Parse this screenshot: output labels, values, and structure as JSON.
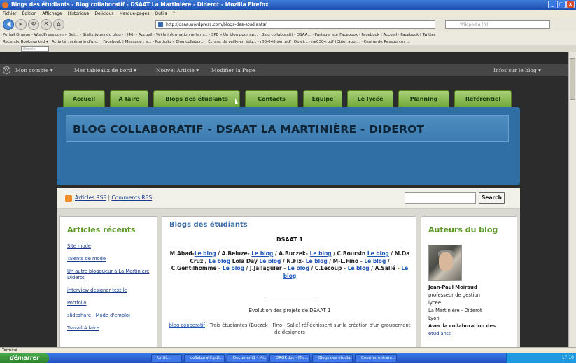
{
  "window": {
    "title": "Blogs des étudiants - Blog collaboratif - DSAAT La Martinière - Diderot - Mozilla Firefox",
    "min": "_",
    "max": "□",
    "close": "x"
  },
  "menu": [
    "Fichier",
    "Édition",
    "Affichage",
    "Historique",
    "Delicious",
    "Marque-pages",
    "Outils",
    "?"
  ],
  "nav": {
    "url": "http://dsaa.wordpress.com/blogs-des-etudiants/",
    "search_placeholder": "Wikipedia (fr)"
  },
  "bookmarks1": "Portail Orange  ·  WordPress.com » Get...  ·  Statistiques du blog  ·  I (46)  ·  Accueil  ·  Veille informationnelle m...  ·  SPE » Un blog pour ap...  ·  Blog collaboratif - DSAA...  ·  Partager sur Facebook  ·  Facebook | Accueil  ·  Facebook | Twitter",
  "bookmarks2": "Recently Bookmarked ▾  ·  Activité : scénario d'un...  ·  Facebook | Message : e...  ·  Portfolio » Blog collabor...  ·  Écrans de veille en édu...  ·  r08-046-syn.pdf (Objet...  ·  ne0304.pdf (Objet appl...  ·  Centre de Ressources ...",
  "google_toolbar": {
    "search": "Google"
  },
  "wp_adminbar": {
    "account": "Mon compte ▾",
    "dashboards": "Mes tableaux de bord ▾",
    "new_post": "Nouvel Article ▾",
    "edit_page": "Modifier la Page",
    "blog_info": "Infos sur le blog ▾"
  },
  "site": {
    "tabs": [
      "Accueil",
      "A faire",
      "Blogs des étudiants",
      "Contacts",
      "Equipe",
      "Le lycée",
      "Planning",
      "Référentiel"
    ],
    "title": "BLOG COLLABORATIF - DSAAT LA MARTINIÈRE - DIDEROT",
    "rss": {
      "articles": "Articles RSS",
      "sep": " | ",
      "comments": "Comments RSS"
    },
    "search_button": "Search"
  },
  "sidebar_left": {
    "heading": "Articles récents",
    "items": [
      "Site mode",
      "Talents de mode",
      "Un autre bloggueur à La Martinière Diderot",
      "interview designer textile",
      "Portfolio",
      "slideshare - Mode d'emploi",
      "Travail A faire"
    ]
  },
  "main": {
    "heading": "Blogs des étudiants",
    "group": "DSAAT 1",
    "names": [
      [
        "M.Abad-",
        "Le blog"
      ],
      [
        " / A.Beluze- ",
        "Le blog"
      ],
      [
        " / A.Buczek- ",
        "Le blog"
      ],
      [
        " / C.Boursin ",
        "Le blog"
      ],
      [
        " / M.Da Cruz / ",
        "Le blog"
      ],
      [
        " Lola Day ",
        "Le blog"
      ],
      [
        " / N.Fix- ",
        "Le blog"
      ],
      [
        " / M-L.Fino - ",
        "Le blog"
      ],
      [
        " / C.Gentilhomme - ",
        "Le blog"
      ],
      [
        " / J.Jallaguier - ",
        "Le blog"
      ],
      [
        " / C.Lecoup - ",
        "Le blog"
      ],
      [
        " / A.Sallé - ",
        "Le blog"
      ]
    ],
    "evolution": "Evolution des projets de DSAAT 1",
    "coop_link": "blog cooperatif",
    "coop_text": " - Trois étudiantes (Buczek - Fino - Sallé) réfléchissent sur la création d'un groupement de designers"
  },
  "sidebar_right": {
    "heading": "Auteurs du blog",
    "name": "Jean-Paul Moiraud",
    "bio": [
      "professeur de gestion",
      "lycée",
      "La Martinière - Diderot",
      "Lyon"
    ],
    "collab": "Avec la collaboration des",
    "students": "étudiants"
  },
  "status": "Terminé",
  "taskbar": {
    "start": "démarrer",
    "tasks": [
      "Untit...",
      "collaboratif.pdf...",
      "Document1 - Mi...",
      "DROP.doc - Mic...",
      "Blogs des étudia...",
      "Courrier entrant..."
    ],
    "clock": "17:10"
  }
}
